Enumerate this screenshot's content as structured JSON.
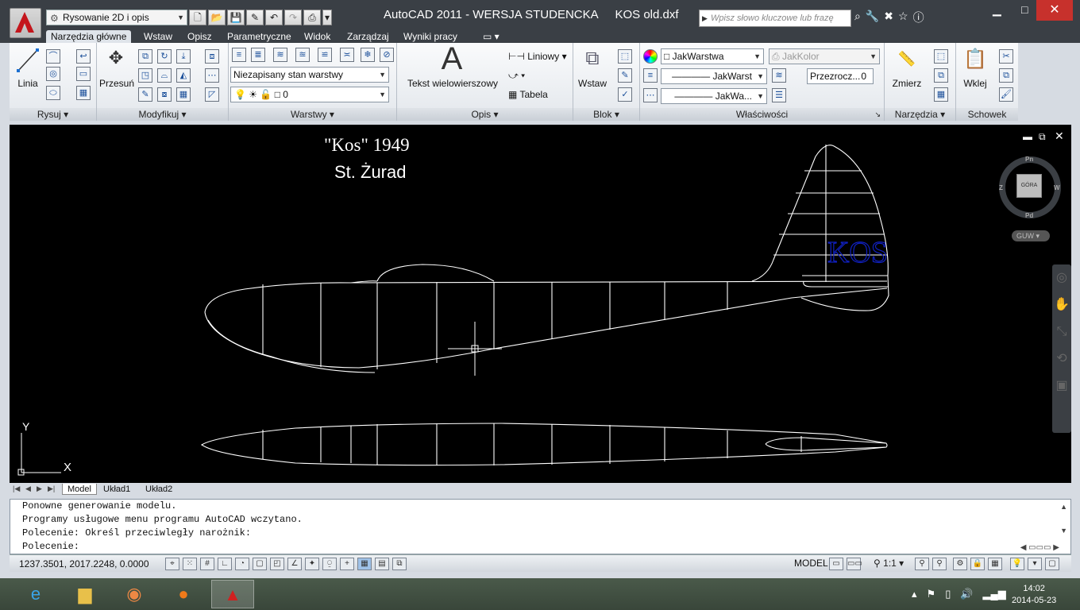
{
  "app": {
    "workspace": "Rysowanie 2D i opis",
    "title": "AutoCAD 2011 - WERSJA STUDENCKA",
    "file": "KOS old.dxf",
    "search_placeholder": "Wpisz słowo kluczowe lub frazę"
  },
  "ribbon_tabs": [
    "Narzędzia główne",
    "Wstaw",
    "Opisz",
    "Parametryczne",
    "Widok",
    "Zarządzaj",
    "Wyniki pracy"
  ],
  "panels": {
    "rysuj": {
      "title": "Rysuj",
      "linia": "Linia"
    },
    "modyfikuj": {
      "title": "Modyfikuj",
      "przesun": "Przesuń"
    },
    "warstwy": {
      "title": "Warstwy",
      "state": "Niezapisany stan warstwy",
      "layer": "0"
    },
    "opis": {
      "title": "Opis",
      "mtext": "Tekst wielowierszowy",
      "liniowy": "Liniowy",
      "tabela": "Tabela"
    },
    "blok": {
      "title": "Blok",
      "wstaw": "Wstaw"
    },
    "wlasciwosci": {
      "title": "Właściwości",
      "color": "JakWarstwa",
      "color2": "JakKolor",
      "linetype": "JakWarst",
      "lineweight": "JakWa...",
      "transp_label": "Przezrocz...",
      "transp_value": "0"
    },
    "narzedzia": {
      "title": "Narzędzia",
      "zmierz": "Zmierz"
    },
    "schowek": {
      "title": "Schowek",
      "wklej": "Wklej"
    }
  },
  "drawing": {
    "title_line1": "\"Kos\" 1949",
    "title_line2": "St. Żurad",
    "tail_label": "KOS",
    "tail_label_color": "#1020c0"
  },
  "viewcube": {
    "top": "GÓRA",
    "n": "Pn",
    "s": "Pd",
    "e": "W",
    "w": "Z",
    "ucs": "GUW"
  },
  "ucs_axes": {
    "x": "X",
    "y": "Y"
  },
  "layout_tabs": [
    "Model",
    "Układ1",
    "Układ2"
  ],
  "command_lines": [
    "Ponowne generowanie modelu.",
    "Programy usługowe menu programu AutoCAD wczytano.",
    "Polecenie: Określ przeciwległy narożnik:",
    "Polecenie:"
  ],
  "status": {
    "coords": "1237.3501, 2017.2248, 0.0000",
    "model": "MODEL",
    "scale": "1:1"
  },
  "taskbar": {
    "time": "14:02",
    "date": "2014-05-23"
  }
}
